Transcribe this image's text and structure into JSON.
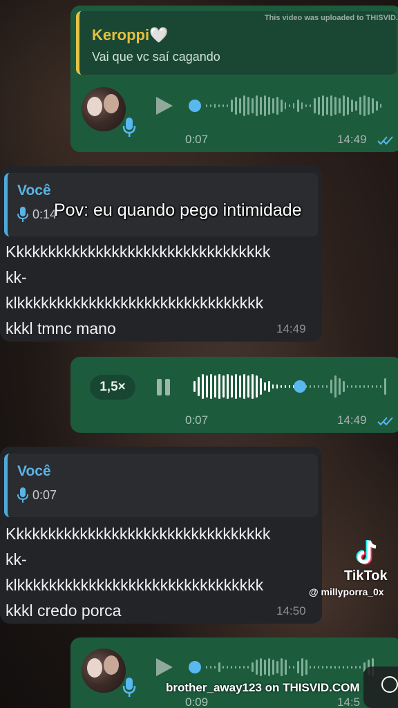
{
  "watermark_top": "This video was uploaded to THISVID.",
  "overlay_caption": "Pov: eu quando pego intimidade",
  "msg1": {
    "quote_name": "Keroppi🤍",
    "quote_text": "Vai que vc saí cagando",
    "duration": "0:07",
    "time": "14:49"
  },
  "msg2": {
    "quote_name": "Você",
    "quote_duration": "0:14",
    "lines": [
      "Kkkkkkkkkkkkkkkkkkkkkkkkkkkkkkkkk",
      "kk-",
      "klkkkkkkkkkkkkkkkkkkkkkkkkkkkkkkk",
      "kkkl tmnc mano"
    ],
    "time": "14:49"
  },
  "msg3": {
    "speed": "1,5×",
    "duration": "0:07",
    "time": "14:49"
  },
  "msg4": {
    "quote_name": "Você",
    "quote_duration": "0:07",
    "lines": [
      "Kkkkkkkkkkkkkkkkkkkkkkkkkkkkkkkkk",
      "kk-",
      "klkkkkkkkkkkkkkkkkkkkkkkkkkkkkkkk",
      "kkkl credo porca"
    ],
    "time": "14:50"
  },
  "msg5": {
    "duration": "0:09",
    "time": "14:5"
  },
  "tiktok": {
    "brand": "TikTok",
    "username": "@ millyporra_0x"
  },
  "watermark_bottom": "brother_away123 on THISVID.COM",
  "colors": {
    "bubble_green": "#1d5b3d",
    "bubble_dark": "#222427",
    "quote_accent_yellow": "#e3c140",
    "quote_accent_blue": "#5bb3e4",
    "read_ticks": "#5ab8f0"
  }
}
